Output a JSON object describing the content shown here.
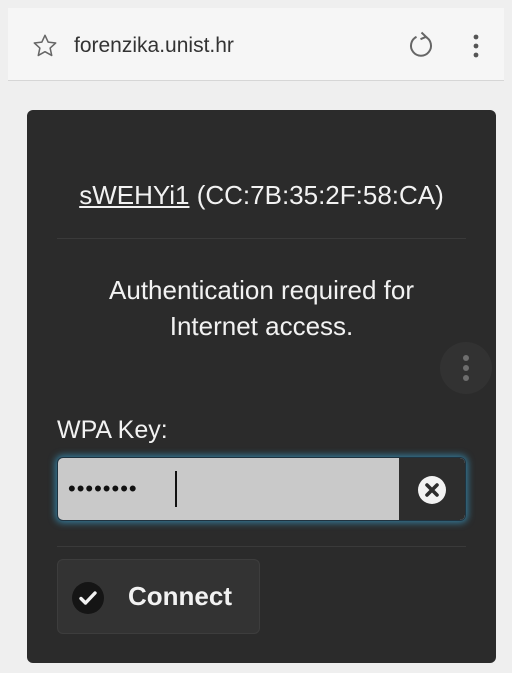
{
  "browser": {
    "url": "forenzika.unist.hr",
    "icons": [
      "star-icon",
      "reload-icon",
      "more-vert-icon"
    ]
  },
  "dialog": {
    "ssid_name": "sWEHYi1",
    "bssid": "(CC:7B:35:2F:58:CA)",
    "auth_message": "Authentication required for Internet access.",
    "key_label": "WPA Key:",
    "key_value": "••••••••",
    "connect_label": "Connect",
    "icons": [
      "kebab-icon",
      "clear-icon",
      "check-icon"
    ]
  },
  "colors": {
    "dialog_bg": "#2b2b2b",
    "field_bg": "#c9c9c9",
    "focus_glow": "#3791b9",
    "text": "#f2f2f2"
  }
}
